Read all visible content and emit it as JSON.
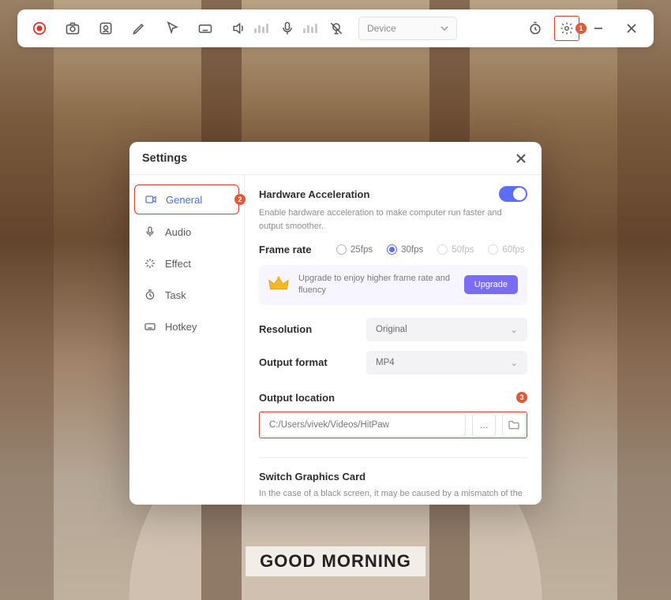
{
  "caption": "GOOD MORNING",
  "toolbar": {
    "device_label": "Device",
    "gear_badge": "1"
  },
  "settings": {
    "title": "Settings",
    "sidebar": {
      "general": "General",
      "general_badge": "2",
      "audio": "Audio",
      "effect": "Effect",
      "task": "Task",
      "hotkey": "Hotkey"
    },
    "hw": {
      "title": "Hardware Acceleration",
      "desc": "Enable hardware acceleration to make computer run faster and output smoother."
    },
    "frame_rate": {
      "label": "Frame rate",
      "o25": "25fps",
      "o30": "30fps",
      "o50": "50fps",
      "o60": "60fps"
    },
    "upgrade": {
      "text": "Upgrade to enjoy higher frame rate and fluency",
      "button": "Upgrade"
    },
    "resolution": {
      "label": "Resolution",
      "value": "Original"
    },
    "output_format": {
      "label": "Output format",
      "value": "MP4"
    },
    "output_location": {
      "label": "Output location",
      "badge": "3",
      "path": "C:/Users/vivek/Videos/HitPaw",
      "more": "..."
    },
    "switch_gpu": {
      "title": "Switch Graphics Card",
      "desc": "In the case of a black screen, it may be caused by a mismatch of the"
    }
  }
}
